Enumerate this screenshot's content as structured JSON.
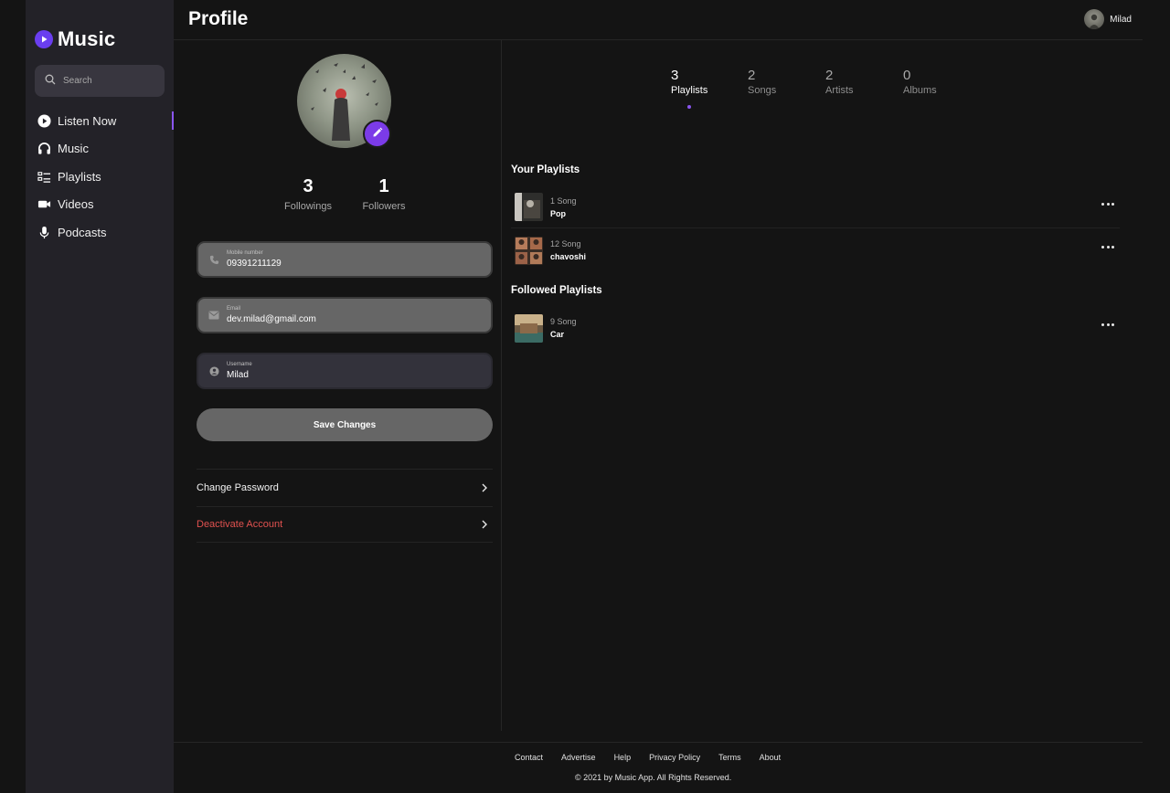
{
  "app": {
    "name": "Music"
  },
  "sidebar": {
    "search_placeholder": "Search",
    "items": [
      {
        "label": "Listen Now",
        "icon": "play-circle-icon",
        "active": true
      },
      {
        "label": "Music",
        "icon": "headphones-icon",
        "active": false
      },
      {
        "label": "Playlists",
        "icon": "playlist-icon",
        "active": false
      },
      {
        "label": "Videos",
        "icon": "video-camera-icon",
        "active": false
      },
      {
        "label": "Podcasts",
        "icon": "microphone-icon",
        "active": false
      }
    ]
  },
  "header": {
    "title": "Profile",
    "user_name": "Milad"
  },
  "profile": {
    "stats": [
      {
        "value": "3",
        "label": "Followings"
      },
      {
        "value": "1",
        "label": "Followers"
      }
    ],
    "fields": {
      "mobile": {
        "label": "Mobile number",
        "value": "09391211129"
      },
      "email": {
        "label": "Email",
        "value": "dev.milad@gmail.com"
      },
      "username": {
        "label": "Username",
        "value": "Milad"
      }
    },
    "save_label": "Save Changes",
    "change_password_label": "Change Password",
    "deactivate_label": "Deactivate Account"
  },
  "tabs": [
    {
      "count": "3",
      "label": "Playlists",
      "active": true
    },
    {
      "count": "2",
      "label": "Songs",
      "active": false
    },
    {
      "count": "2",
      "label": "Artists",
      "active": false
    },
    {
      "count": "0",
      "label": "Albums",
      "active": false
    }
  ],
  "your_playlists": {
    "title": "Your Playlists",
    "items": [
      {
        "count": "1 Song",
        "name": "Pop"
      },
      {
        "count": "12 Song",
        "name": "chavoshi"
      }
    ]
  },
  "followed_playlists": {
    "title": "Followed Playlists",
    "items": [
      {
        "count": "9 Song",
        "name": "Car"
      }
    ]
  },
  "footer": {
    "links": [
      "Contact",
      "Advertise",
      "Help",
      "Privacy Policy",
      "Terms",
      "About"
    ],
    "copyright": "© 2021 by Music App. All Rights Reserved."
  },
  "colors": {
    "accent": "#8a55f0",
    "edit_button": "#7b3be8",
    "danger": "#e0514f"
  }
}
